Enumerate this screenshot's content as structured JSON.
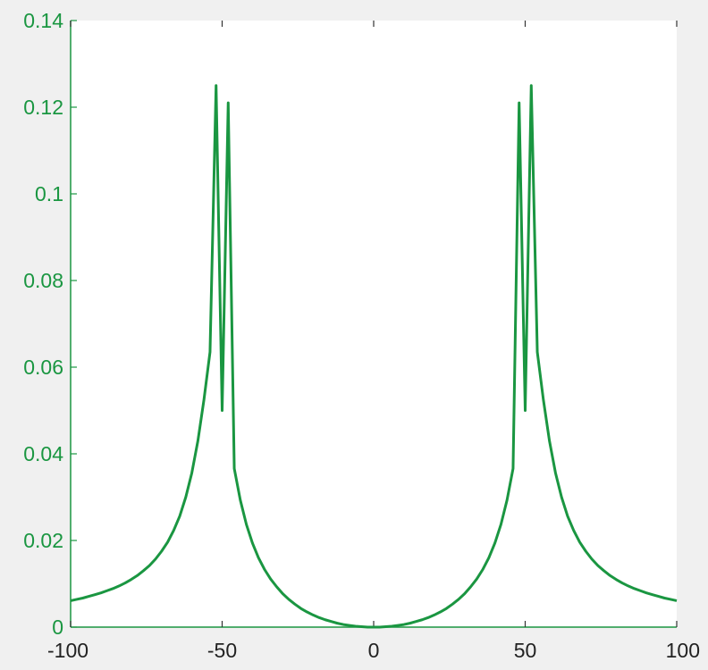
{
  "chart_data": {
    "type": "line",
    "title": "",
    "xlabel": "",
    "ylabel": "",
    "xlim": [
      -100,
      100
    ],
    "ylim": [
      0,
      0.14
    ],
    "grid": false,
    "legend": "none",
    "x_ticks": [
      "-100",
      "-50",
      "0",
      "50",
      "100"
    ],
    "y_ticks": [
      "0",
      "0.02",
      "0.04",
      "0.06",
      "0.08",
      "0.1",
      "0.12",
      "0.14"
    ],
    "colors": {
      "line": "#1a9641",
      "axis": "#1a9641",
      "plot_background": "#ffffff",
      "figure_background": "#f0f0f0"
    },
    "series": [
      {
        "x": [
          -100,
          -98,
          -96,
          -94,
          -92,
          -90,
          -88,
          -86,
          -84,
          -82,
          -80,
          -78,
          -76,
          -74,
          -72,
          -70,
          -68,
          -66,
          -64,
          -62,
          -60,
          -58,
          -56,
          -54,
          -52,
          -50,
          -48,
          -46,
          -44,
          -42,
          -40,
          -38,
          -36,
          -34,
          -32,
          -30,
          -28,
          -26,
          -24,
          -22,
          -20,
          -18,
          -16,
          -14,
          -12,
          -10,
          -8,
          -6,
          -4,
          -2,
          0,
          2,
          4,
          6,
          8,
          10,
          12,
          14,
          16,
          18,
          20,
          22,
          24,
          26,
          28,
          30,
          32,
          34,
          36,
          38,
          40,
          42,
          44,
          46,
          48,
          50,
          52,
          54,
          56,
          58,
          60,
          62,
          64,
          66,
          68,
          70,
          72,
          74,
          76,
          78,
          80,
          82,
          84,
          86,
          88,
          90,
          92,
          94,
          96,
          98,
          100
        ],
        "y": [
          0.0061,
          0.0064,
          0.0067,
          0.0071,
          0.0075,
          0.0079,
          0.0084,
          0.0089,
          0.0095,
          0.0102,
          0.011,
          0.0119,
          0.013,
          0.0142,
          0.0157,
          0.0175,
          0.0196,
          0.0223,
          0.0256,
          0.03,
          0.0356,
          0.043,
          0.0525,
          0.0635,
          0.125,
          0.05,
          0.121,
          0.0366,
          0.0293,
          0.0237,
          0.0194,
          0.016,
          0.0133,
          0.0111,
          0.0093,
          0.0077,
          0.0064,
          0.0053,
          0.0043,
          0.0035,
          0.0028,
          0.0022,
          0.0017,
          0.0013,
          0.0009,
          0.0006,
          0.0004,
          0.0002,
          0.0001,
          0.0,
          0.0,
          0.0,
          0.0001,
          0.0002,
          0.0004,
          0.0006,
          0.0009,
          0.0013,
          0.0017,
          0.0022,
          0.0028,
          0.0035,
          0.0043,
          0.0053,
          0.0064,
          0.0077,
          0.0093,
          0.0111,
          0.0133,
          0.016,
          0.0194,
          0.0237,
          0.0293,
          0.0366,
          0.121,
          0.05,
          0.125,
          0.0635,
          0.0525,
          0.043,
          0.0356,
          0.03,
          0.0256,
          0.0223,
          0.0196,
          0.0175,
          0.0157,
          0.0142,
          0.013,
          0.0119,
          0.011,
          0.0102,
          0.0095,
          0.0089,
          0.0084,
          0.0079,
          0.0075,
          0.0071,
          0.0067,
          0.0064,
          0.0061
        ]
      }
    ]
  }
}
